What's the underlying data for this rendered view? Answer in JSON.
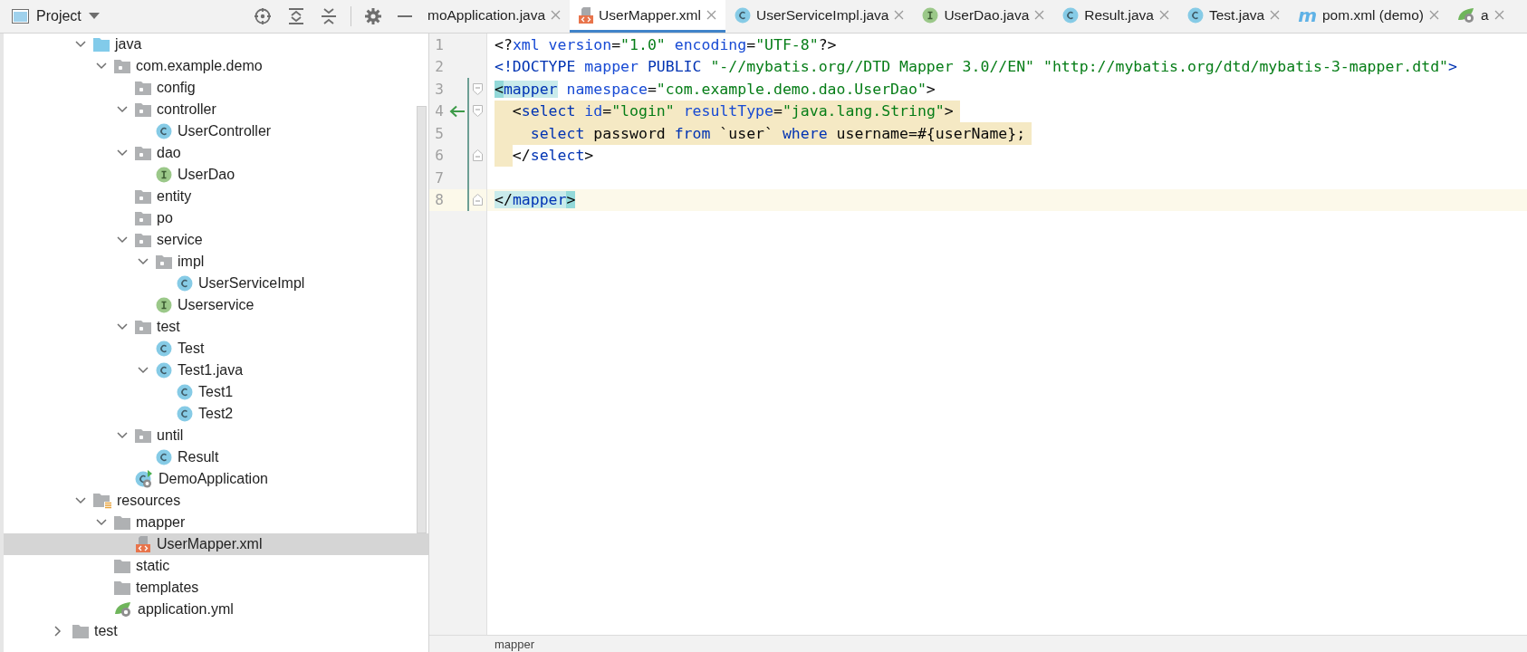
{
  "project_panel": {
    "title": "Project"
  },
  "tabs": [
    {
      "label": "moApplication.java",
      "kind": "none",
      "selected": false
    },
    {
      "label": "UserMapper.xml",
      "kind": "xml",
      "selected": true
    },
    {
      "label": "UserServiceImpl.java",
      "kind": "class",
      "selected": false
    },
    {
      "label": "UserDao.java",
      "kind": "interface",
      "selected": false
    },
    {
      "label": "Result.java",
      "kind": "class",
      "selected": false
    },
    {
      "label": "Test.java",
      "kind": "class",
      "selected": false
    },
    {
      "label": "pom.xml (demo)",
      "kind": "maven",
      "icon_text": "m",
      "selected": false
    },
    {
      "label": "a",
      "kind": "spring",
      "selected": false
    }
  ],
  "tree": {
    "nodes": [
      {
        "label": "java",
        "kind": "source",
        "expanded": true,
        "selected": false,
        "children": [
          {
            "label": "com.example.demo",
            "kind": "package",
            "expanded": true,
            "selected": false,
            "children": [
              {
                "label": "config",
                "kind": "package",
                "selected": false
              },
              {
                "label": "controller",
                "kind": "package",
                "expanded": true,
                "selected": false,
                "children": [
                  {
                    "label": "UserController",
                    "kind": "class",
                    "selected": false
                  }
                ]
              },
              {
                "label": "dao",
                "kind": "package",
                "expanded": true,
                "selected": false,
                "children": [
                  {
                    "label": "UserDao",
                    "kind": "interface",
                    "selected": false
                  }
                ]
              },
              {
                "label": "entity",
                "kind": "package",
                "selected": false
              },
              {
                "label": "po",
                "kind": "package",
                "selected": false
              },
              {
                "label": "service",
                "kind": "package",
                "expanded": true,
                "selected": false,
                "children": [
                  {
                    "label": "impl",
                    "kind": "package",
                    "expanded": true,
                    "selected": false,
                    "children": [
                      {
                        "label": "UserServiceImpl",
                        "kind": "class",
                        "selected": false
                      }
                    ]
                  },
                  {
                    "label": "Userservice",
                    "kind": "interface",
                    "selected": false
                  }
                ]
              },
              {
                "label": "test",
                "kind": "package",
                "expanded": true,
                "selected": false,
                "children": [
                  {
                    "label": "Test",
                    "kind": "class",
                    "selected": false
                  },
                  {
                    "label": "Test1.java",
                    "kind": "class",
                    "expanded": true,
                    "selected": false,
                    "children": [
                      {
                        "label": "Test1",
                        "kind": "class",
                        "selected": false
                      },
                      {
                        "label": "Test2",
                        "kind": "class",
                        "selected": false
                      }
                    ]
                  }
                ]
              },
              {
                "label": "until",
                "kind": "package",
                "expanded": true,
                "selected": false,
                "children": [
                  {
                    "label": "Result",
                    "kind": "class",
                    "selected": false
                  }
                ]
              },
              {
                "label": "DemoApplication",
                "kind": "spring_app",
                "selected": false
              }
            ]
          }
        ]
      },
      {
        "label": "resources",
        "kind": "resources",
        "expanded": true,
        "selected": false,
        "children": [
          {
            "label": "mapper",
            "kind": "folder",
            "expanded": true,
            "selected": false,
            "children": [
              {
                "label": "UserMapper.xml",
                "kind": "xml",
                "selected": true
              }
            ]
          },
          {
            "label": "static",
            "kind": "folder",
            "selected": false
          },
          {
            "label": "templates",
            "kind": "folder",
            "selected": false
          },
          {
            "label": "application.yml",
            "kind": "yaml",
            "selected": false
          }
        ]
      }
    ],
    "parent_level_nodes": [
      {
        "label": "test",
        "kind": "folder",
        "expanded": false,
        "selected": false
      }
    ]
  },
  "editor": {
    "lines": [
      {
        "number": "1",
        "changed": false,
        "current": false,
        "tokens": [
          {
            "text": "<?",
            "kind": "punct"
          },
          {
            "text": "xml",
            "kind": "attr"
          },
          {
            "text": " version",
            "kind": "attr"
          },
          {
            "text": "=",
            "kind": "punct"
          },
          {
            "text": "\"1.0\"",
            "kind": "value"
          },
          {
            "text": " encoding",
            "kind": "attr"
          },
          {
            "text": "=",
            "kind": "punct"
          },
          {
            "text": "\"UTF-8\"",
            "kind": "value"
          },
          {
            "text": "?>",
            "kind": "punct"
          }
        ]
      },
      {
        "number": "2",
        "changed": false,
        "current": false,
        "tokens": [
          {
            "text": "<!DOCTYPE",
            "kind": "tag"
          },
          {
            "text": " mapper",
            "kind": "attr"
          },
          {
            "text": " PUBLIC",
            "kind": "tag"
          },
          {
            "text": " \"-//mybatis.org//DTD Mapper 3.0//EN\"",
            "kind": "value"
          },
          {
            "text": " \"http://mybatis.org/dtd/mybatis-3-mapper.dtd\"",
            "kind": "value"
          },
          {
            "text": ">",
            "kind": "tag"
          }
        ]
      },
      {
        "number": "3",
        "changed": true,
        "current": false,
        "fold_start": true,
        "tokens": [
          {
            "text": "<",
            "kind": "punct",
            "matched": true,
            "strong": true
          },
          {
            "text": "mapper",
            "kind": "tag",
            "matched": true
          },
          {
            "text": " namespace",
            "kind": "attr"
          },
          {
            "text": "=",
            "kind": "punct"
          },
          {
            "text": "\"com.example.demo.dao.UserDao\"",
            "kind": "value"
          },
          {
            "text": ">",
            "kind": "punct"
          }
        ]
      },
      {
        "number": "4",
        "changed": true,
        "current": false,
        "fold_start": true,
        "arrow": true,
        "highlighted": true,
        "tokens": [
          {
            "text": "  <",
            "kind": "punct"
          },
          {
            "text": "select",
            "kind": "tag"
          },
          {
            "text": " id",
            "kind": "attr"
          },
          {
            "text": "=",
            "kind": "punct"
          },
          {
            "text": "\"login\"",
            "kind": "value"
          },
          {
            "text": " resultType",
            "kind": "attr"
          },
          {
            "text": "=",
            "kind": "punct"
          },
          {
            "text": "\"java.lang.String\"",
            "kind": "value"
          },
          {
            "text": ">",
            "kind": "punct"
          }
        ]
      },
      {
        "number": "5",
        "changed": true,
        "current": false,
        "highlighted": true,
        "tokens": [
          {
            "text": "    select",
            "kind": "keyword"
          },
          {
            "text": " password",
            "kind": "text"
          },
          {
            "text": " from",
            "kind": "keyword"
          },
          {
            "text": " `user`",
            "kind": "text"
          },
          {
            "text": " where",
            "kind": "keyword"
          },
          {
            "text": " username=#{userName};",
            "kind": "text"
          }
        ]
      },
      {
        "number": "6",
        "changed": true,
        "current": false,
        "fold_end": true,
        "indent_highlighted": true,
        "tokens": [
          {
            "text": "  </",
            "kind": "punct"
          },
          {
            "text": "select",
            "kind": "tag"
          },
          {
            "text": ">",
            "kind": "punct"
          }
        ]
      },
      {
        "number": "7",
        "changed": true,
        "current": false
      },
      {
        "number": "8",
        "changed": true,
        "current": true,
        "fold_end": true,
        "tokens": [
          {
            "text": "</",
            "kind": "punct",
            "matched": true
          },
          {
            "text": "mapper",
            "kind": "tag",
            "matched": true
          },
          {
            "text": ">",
            "kind": "punct",
            "matched": true,
            "strong": true
          }
        ]
      }
    ]
  },
  "breadcrumb": "mapper"
}
